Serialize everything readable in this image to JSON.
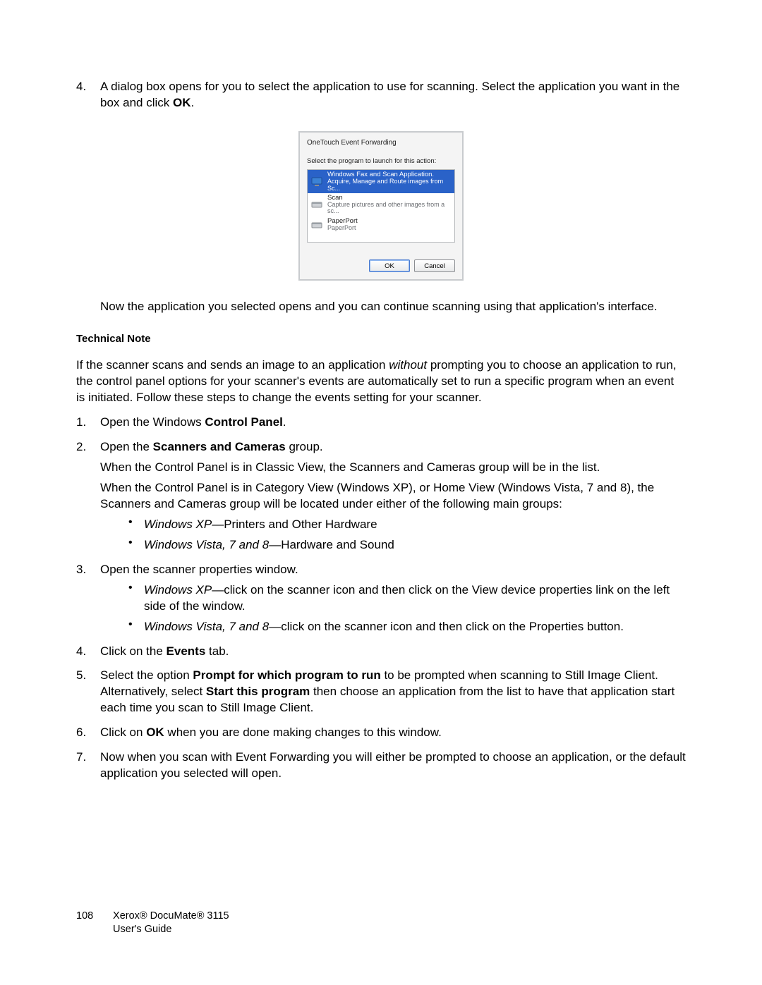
{
  "step4": {
    "num": "4.",
    "text_before_bold": "A dialog box opens for you to select the application to use for scanning. Select the application you want in the box and click ",
    "bold": "OK",
    "text_after_bold": "."
  },
  "dialog": {
    "title": "OneTouch Event Forwarding",
    "prompt": "Select the program to launch for this action:",
    "items": [
      {
        "name": "Windows Fax and Scan Application.",
        "desc": "Acquire, Manage and Route images from Sc...",
        "selected": true,
        "icon": "monitor"
      },
      {
        "name": "Scan",
        "desc": "Capture pictures and other images from a sc...",
        "selected": false,
        "icon": "scanner"
      },
      {
        "name": "PaperPort",
        "desc": "PaperPort",
        "selected": false,
        "icon": "scanner"
      }
    ],
    "ok": "OK",
    "cancel": "Cancel"
  },
  "after_dialog": "Now the application you selected opens and you can continue scanning using that application's interface.",
  "tech_note_heading": "Technical Note",
  "tech_note_p1_a": "If the scanner scans and sends an image to an application ",
  "tech_note_p1_i": "without",
  "tech_note_p1_b": " prompting you to choose an application to run, the control panel options for your scanner's events are automatically set to run a specific program when an event is initiated. Follow these steps to change the events setting for your scanner.",
  "steps": [
    {
      "num": "1.",
      "parts": [
        {
          "t": "Open the Windows "
        },
        {
          "b": "Control Panel"
        },
        {
          "t": "."
        }
      ]
    },
    {
      "num": "2.",
      "parts": [
        {
          "t": "Open the "
        },
        {
          "b": "Scanners and Cameras"
        },
        {
          "t": " group."
        }
      ],
      "sub_paras": [
        "When the Control Panel is in Classic View, the Scanners and Cameras group will be in the list.",
        "When the Control Panel is in Category View (Windows XP), or Home View (Windows Vista, 7 and 8), the Scanners and Cameras group will be located under either of the following main groups:"
      ],
      "bullets": [
        {
          "i": "Windows XP",
          "t": "—Printers and Other Hardware"
        },
        {
          "i": "Windows Vista, 7 and 8",
          "t": "—Hardware and Sound"
        }
      ]
    },
    {
      "num": "3.",
      "parts": [
        {
          "t": "Open the scanner properties window."
        }
      ],
      "bullets": [
        {
          "i": "Windows XP",
          "t": "—click on the scanner icon and then click on the View device properties link on the left side of the window."
        },
        {
          "i": "Windows Vista, 7 and 8",
          "t": "—click on the scanner icon and then click on the Properties button."
        }
      ]
    },
    {
      "num": "4.",
      "parts": [
        {
          "t": "Click on the "
        },
        {
          "b": "Events"
        },
        {
          "t": " tab."
        }
      ]
    },
    {
      "num": "5.",
      "parts": [
        {
          "t": "Select the option "
        },
        {
          "b": "Prompt for which program to run"
        },
        {
          "t": " to be prompted when scanning to Still Image Client. Alternatively, select "
        },
        {
          "b": "Start this program"
        },
        {
          "t": " then choose an application from the list to have that application start each time you scan to Still Image Client."
        }
      ]
    },
    {
      "num": "6.",
      "parts": [
        {
          "t": "Click on "
        },
        {
          "b": "OK"
        },
        {
          "t": " when you are done making changes to this window."
        }
      ]
    },
    {
      "num": "7.",
      "parts": [
        {
          "t": "Now when you scan with Event Forwarding you will either be prompted to choose an application, or the default application you selected will open."
        }
      ]
    }
  ],
  "footer": {
    "page": "108",
    "line1": "Xerox® DocuMate® 3115",
    "line2": "User's Guide"
  }
}
